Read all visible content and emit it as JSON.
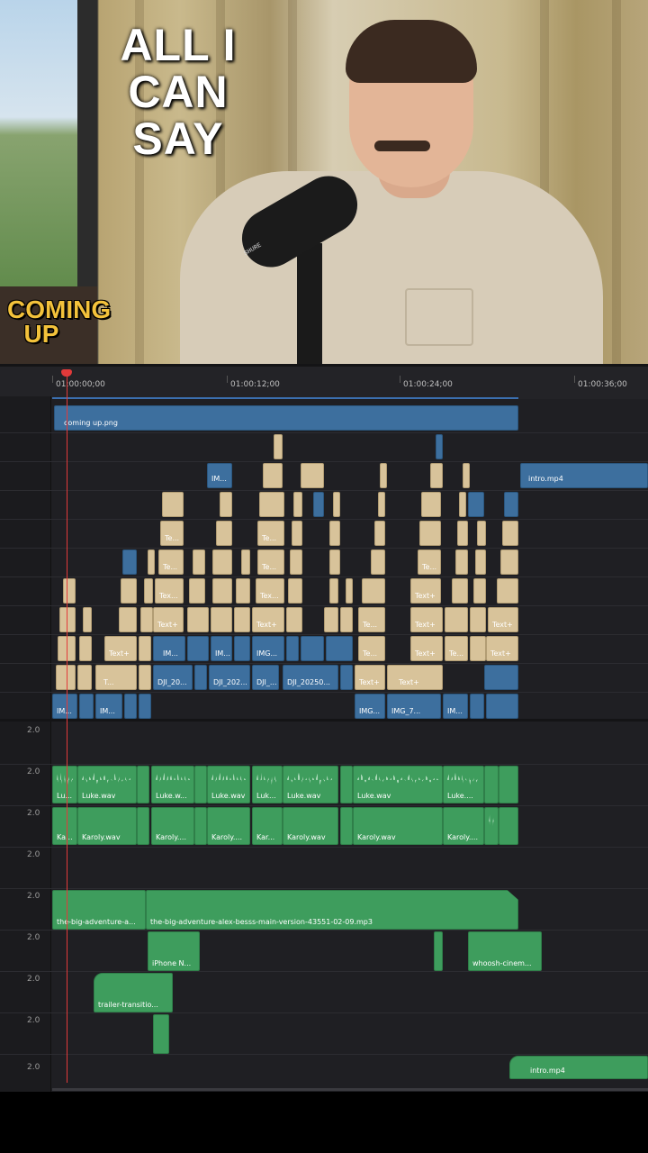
{
  "video": {
    "caption": "ALL I CAN SAY",
    "badge": "COMING UP",
    "mic_brand": "SHURE"
  },
  "timeline": {
    "timecodes": [
      "01:00:00;00",
      "01:00:12;00",
      "01:00:24;00",
      "01:00:36;00"
    ],
    "track_levels": [
      "2.0",
      "2.0",
      "2.0",
      "2.0",
      "2.0",
      "2.0",
      "2.0",
      "2.0",
      "2.0"
    ],
    "video_clips": {
      "coming_up": "coming up.png",
      "intro_video": "intro.mp4",
      "im_1": "IM...",
      "im_2": "IM...",
      "im_3": "IM...",
      "im_4": "IM...",
      "im_5": "IM...",
      "img_1": "IMG...",
      "img_2": "IMG...",
      "img_3": "IMG_7...",
      "dji_1": "DJI_20...",
      "dji_2": "DJI_202...",
      "dji_3": "DJI_...",
      "dji_4": "DJI_20250...",
      "text_t": "T...",
      "text_plus": "Text+",
      "text_te": "Te...",
      "text_tex": "Tex..."
    },
    "audio_clips": {
      "luke_short": "Lu...",
      "luke_1": "Luke.wav",
      "luke_2": "Luke.w...",
      "luke_3": "Luke.wav",
      "luke_4": "Luk...",
      "luke_5": "Luke.wav",
      "luke_6": "Luke.wav",
      "luke_7": "Luke....",
      "karoly_short": "Ka...",
      "karoly_1": "Karoly.wav",
      "karoly_2": "Karoly....",
      "karoly_3": "Karoly....",
      "karoly_4": "Kar...",
      "karoly_5": "Karoly.wav",
      "karoly_6": "Karoly.wav",
      "karoly_7": "Karoly....",
      "music_short": "the-big-adventure-a...",
      "music_main": "the-big-adventure-alex-besss-main-version-43551-02-09.mp3",
      "iphone": "iPhone N...",
      "whoosh": "whoosh-cinem...",
      "trailer": "trailer-transitio...",
      "intro_audio": "intro.mp4"
    }
  }
}
